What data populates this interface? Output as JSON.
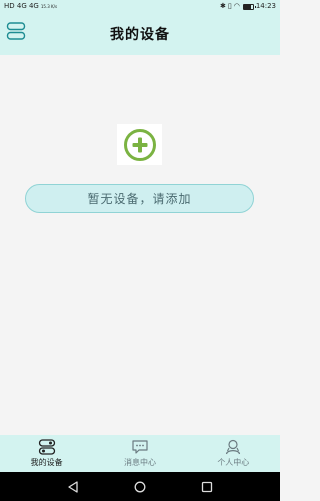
{
  "status_bar": {
    "carrier_icons": "HD 4G 4G",
    "net_speed": "15.3 K/s",
    "time": "14:23",
    "battery_level": 0.85
  },
  "header": {
    "title": "我的设备"
  },
  "main": {
    "empty_message": "暂无设备，请添加"
  },
  "bottom_nav": {
    "items": [
      {
        "label": "我的设备",
        "icon": "devices-icon",
        "active": true
      },
      {
        "label": "消息中心",
        "icon": "message-icon",
        "active": false
      },
      {
        "label": "个人中心",
        "icon": "profile-icon",
        "active": false
      }
    ]
  },
  "colors": {
    "accent": "#d3f3f0",
    "plus_green": "#7bb342",
    "pill_border": "#90d3d5"
  }
}
